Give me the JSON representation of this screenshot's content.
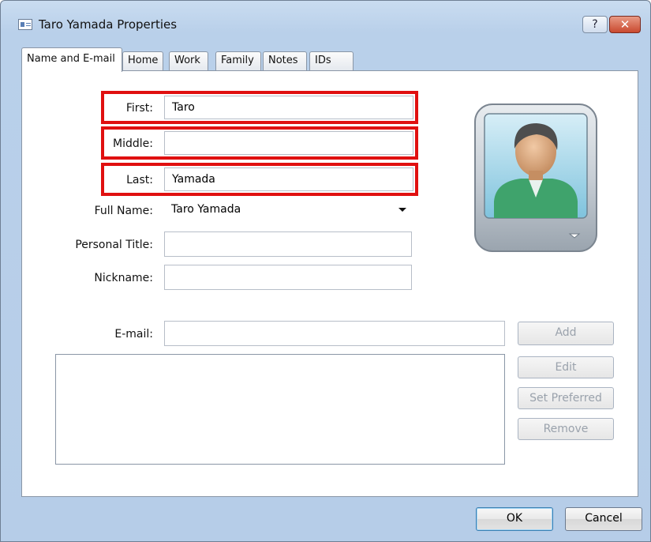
{
  "window": {
    "title": "Taro Yamada Properties",
    "icon": "contact-card-icon"
  },
  "title_buttons": {
    "help": "?",
    "close": "✕"
  },
  "tabs": [
    {
      "label": "Name and E-mail",
      "active": true
    },
    {
      "label": "Home"
    },
    {
      "label": "Work"
    },
    {
      "label": "Family"
    },
    {
      "label": "Notes"
    },
    {
      "label": "IDs"
    }
  ],
  "form": {
    "first_label": "First:",
    "first_value": "Taro",
    "middle_label": "Middle:",
    "middle_value": "",
    "last_label": "Last:",
    "last_value": "Yamada",
    "fullname_label": "Full Name:",
    "fullname_value": "Taro Yamada",
    "title_label": "Personal Title:",
    "title_value": "",
    "nickname_label": "Nickname:",
    "nickname_value": "",
    "email_label": "E-mail:",
    "email_value": ""
  },
  "email_buttons": {
    "add": "Add",
    "edit": "Edit",
    "set_preferred": "Set Preferred",
    "remove": "Remove"
  },
  "footer": {
    "ok": "OK",
    "cancel": "Cancel"
  },
  "colors": {
    "highlight": "#e01010",
    "window_frame": "#b9d0ea",
    "avatar_shirt": "#3fa36c"
  }
}
